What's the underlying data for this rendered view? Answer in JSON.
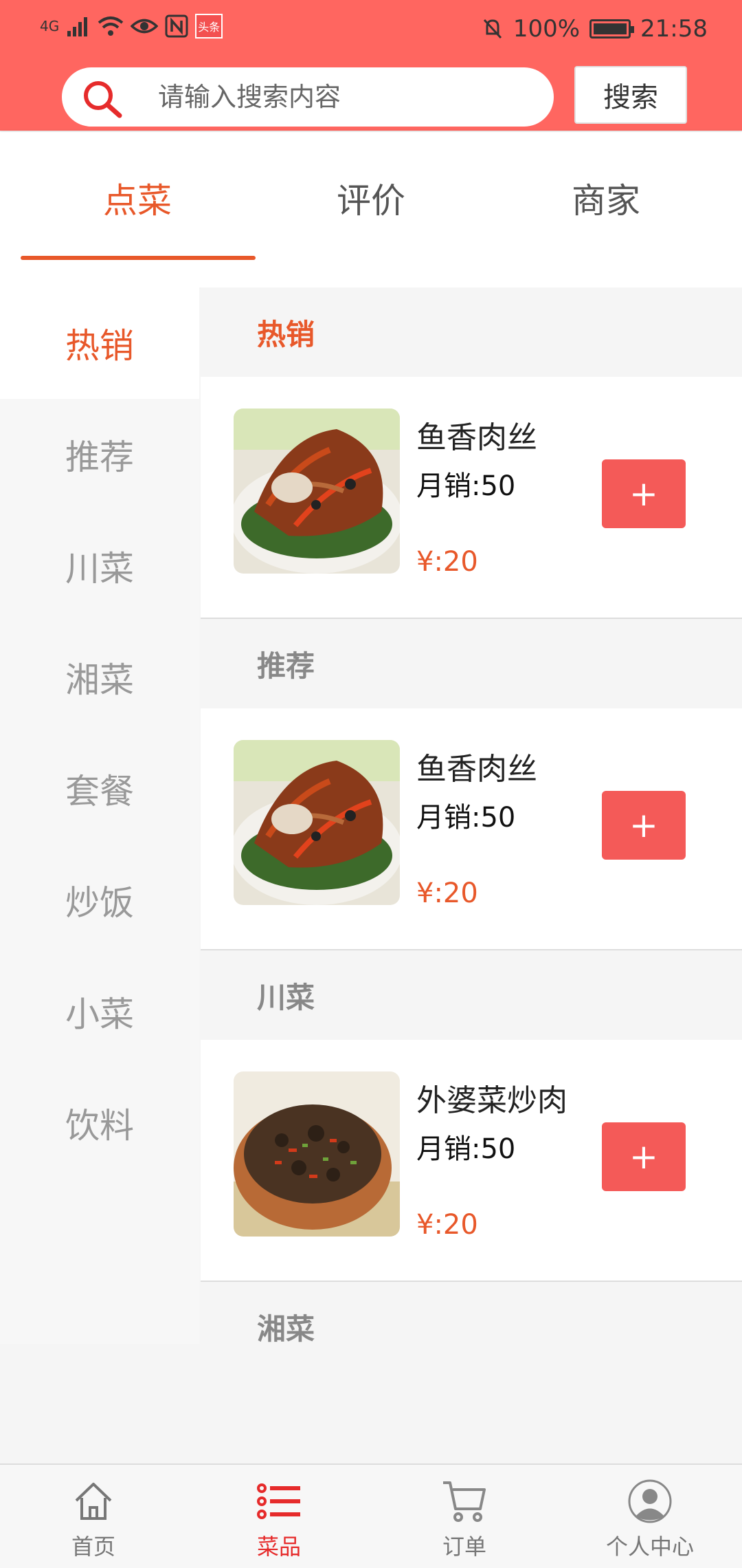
{
  "status_bar": {
    "network": "4G",
    "badge": "头条",
    "battery": "100%",
    "time": "21:58"
  },
  "search": {
    "placeholder": "请输入搜索内容",
    "button_label": "搜索"
  },
  "tabs": [
    {
      "label": "点菜",
      "active": true
    },
    {
      "label": "评价",
      "active": false
    },
    {
      "label": "商家",
      "active": false
    }
  ],
  "categories": [
    {
      "label": "热销",
      "active": true
    },
    {
      "label": "推荐",
      "active": false
    },
    {
      "label": "川菜",
      "active": false
    },
    {
      "label": "湘菜",
      "active": false
    },
    {
      "label": "套餐",
      "active": false
    },
    {
      "label": "炒饭",
      "active": false
    },
    {
      "label": "小菜",
      "active": false
    },
    {
      "label": "饮料",
      "active": false
    }
  ],
  "sections": [
    {
      "title": "热销",
      "active": true,
      "dish": {
        "name": "鱼香肉丝",
        "sales": "月销:50",
        "price": "¥:20",
        "add": "+"
      }
    },
    {
      "title": "推荐",
      "active": false,
      "dish": {
        "name": "鱼香肉丝",
        "sales": "月销:50",
        "price": "¥:20",
        "add": "+"
      }
    },
    {
      "title": "川菜",
      "active": false,
      "dish": {
        "name": "外婆菜炒肉",
        "sales": "月销:50",
        "price": "¥:20",
        "add": "+"
      }
    },
    {
      "title": "湘菜",
      "active": false
    }
  ],
  "bottom_nav": [
    {
      "label": "首页",
      "icon": "home-icon",
      "active": false
    },
    {
      "label": "菜品",
      "icon": "list-icon",
      "active": true
    },
    {
      "label": "订单",
      "icon": "cart-icon",
      "active": false
    },
    {
      "label": "个人中心",
      "icon": "user-icon",
      "active": false
    }
  ],
  "colors": {
    "header": "#ff6660",
    "accent": "#e8582a",
    "add_button": "#f45a58",
    "nav_active": "#e62b2b"
  }
}
